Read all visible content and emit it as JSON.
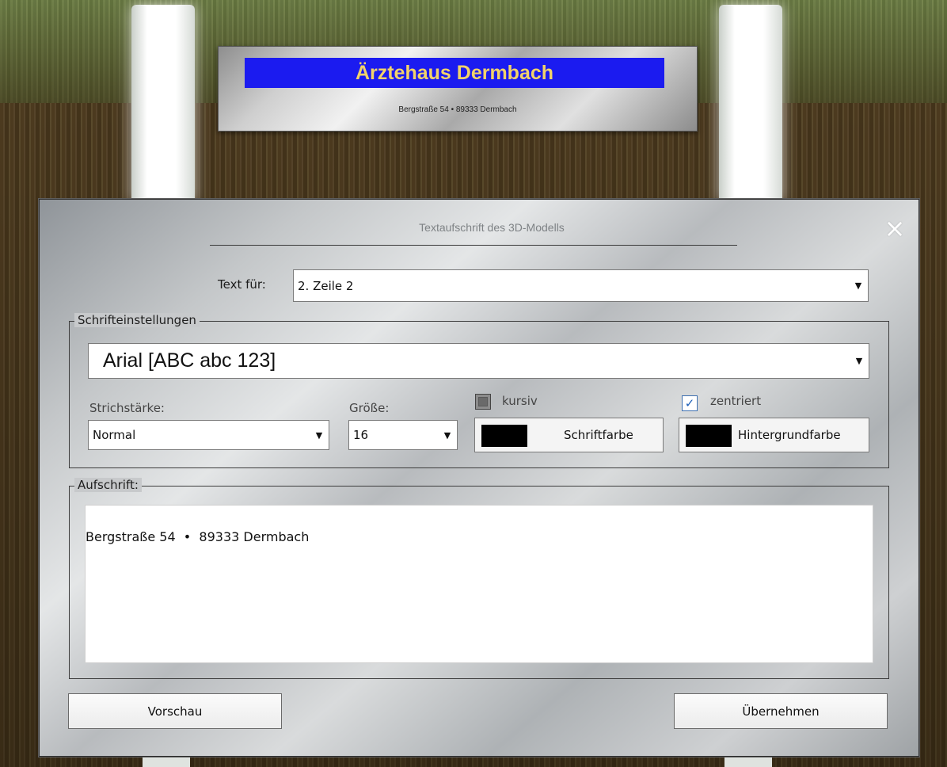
{
  "scene": {
    "sign": {
      "title": "Ärztehaus Dermbach",
      "subtitle": "Bergstraße 54  •  89333 Dermbach",
      "band_color": "#1b1bf0",
      "title_color": "#f2d36a"
    }
  },
  "dialog": {
    "title": "Textaufschrift des 3D-Modells",
    "close_icon": "×",
    "text_for": {
      "label": "Text für:",
      "value": "2. Zeile 2"
    },
    "font_settings": {
      "legend": "Schrifteinstellungen",
      "font": "Arial  [ABC abc 123]",
      "weight_label": "Strichstärke:",
      "weight_value": "Normal",
      "size_label": "Größe:",
      "size_value": "16",
      "italic": {
        "label": "kursiv",
        "checked": false
      },
      "centered": {
        "label": "zentriert",
        "checked": true
      },
      "font_color_button": "Schriftfarbe",
      "background_color_button": "Hintergrundfarbe",
      "font_color": "#000000",
      "background_color": "#000000"
    },
    "inscription": {
      "legend": "Aufschrift:",
      "text": "Bergstraße 54  •  89333 Dermbach"
    },
    "buttons": {
      "preview": "Vorschau",
      "apply": "Übernehmen"
    }
  }
}
